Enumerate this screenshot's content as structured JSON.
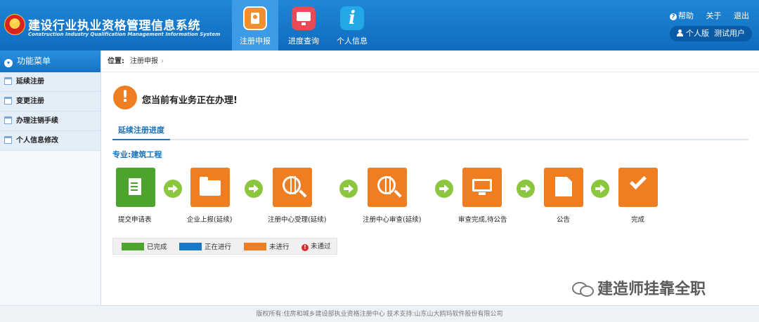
{
  "header": {
    "title": "建设行业执业资格管理信息系统",
    "subtitle": "Construction Industry Qualification Management Information System",
    "nav": [
      {
        "label": "注册申报",
        "icon": "register-icon"
      },
      {
        "label": "进度查询",
        "icon": "progress-monitor-icon"
      },
      {
        "label": "个人信息",
        "icon": "info-icon"
      }
    ],
    "links": {
      "help": "帮助",
      "about": "关于",
      "exit": "退出"
    },
    "user": {
      "edition": "个人版",
      "name": "测试用户"
    }
  },
  "sidebar": {
    "heading": "功能菜单",
    "items": [
      {
        "label": "延续注册"
      },
      {
        "label": "变更注册"
      },
      {
        "label": "办理注销手续"
      },
      {
        "label": "个人信息修改"
      }
    ]
  },
  "breadcrumb": {
    "prefix": "位置:",
    "current": "注册申报"
  },
  "alert": {
    "text": "您当前有业务正在办理!"
  },
  "tab": {
    "label": "延续注册进度"
  },
  "major": {
    "text": "专业:建筑工程"
  },
  "steps": [
    {
      "label": "提交申请表",
      "status": "done",
      "icon": "form-submit-icon"
    },
    {
      "label": "企业上报(延续)",
      "status": "todo",
      "icon": "folder-lock-icon"
    },
    {
      "label": "注册中心受理(延续)",
      "status": "todo",
      "icon": "globe-search-icon"
    },
    {
      "label": "注册中心审查(延续)",
      "status": "todo",
      "icon": "globe-search-icon"
    },
    {
      "label": "审查完成,待公告",
      "status": "todo",
      "icon": "monitor-icon"
    },
    {
      "label": "公告",
      "status": "todo",
      "icon": "document-icon"
    },
    {
      "label": "完成",
      "status": "todo",
      "icon": "checkmark-icon"
    }
  ],
  "legend": {
    "done": {
      "label": "已完成",
      "color": "#4da32d"
    },
    "in_progress": {
      "label": "正在进行",
      "color": "#1a78c9"
    },
    "todo": {
      "label": "未进行",
      "color": "#ef7d21"
    },
    "failed": {
      "label": "未通过",
      "color": "#e02a2a"
    }
  },
  "watermark": {
    "text": "建造师挂靠全职"
  },
  "footer": {
    "text": "版权所有:住房和城乡建设部执业资格注册中心   技术支持:山东山大鸥玛软件股份有限公司"
  }
}
